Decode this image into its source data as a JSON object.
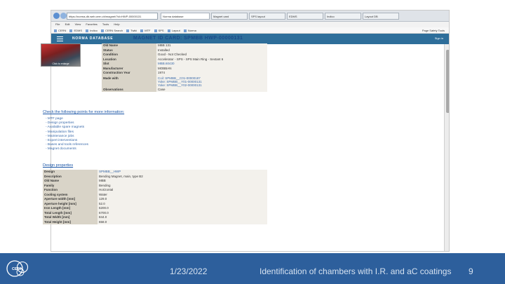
{
  "browser": {
    "url": "https://norma-db.web.cern.ch/magnet/?id=HWP-00000131",
    "tabs": [
      {
        "label": "Norma database",
        "active": true
      },
      {
        "label": "Magnet card",
        "active": false
      },
      {
        "label": "SPS layout",
        "active": false
      },
      {
        "label": "EDMS",
        "active": false
      },
      {
        "label": "Indico",
        "active": false
      },
      {
        "label": "Layout DB",
        "active": false
      }
    ],
    "menu": [
      "File",
      "Edit",
      "View",
      "Favorites",
      "Tools",
      "Help"
    ],
    "favorites": [
      "CERN",
      "EDMS",
      "Indico",
      "CERN Search",
      "Twiki",
      "MTF",
      "SPS",
      "Layout",
      "Norma"
    ],
    "toolbar_right": "Page  Safety  Tools"
  },
  "app": {
    "title": "NORMA DATABASE",
    "signin": "Sign in"
  },
  "card": {
    "title": "MAGNET ID CARD: SPMBB   HWP-00000131",
    "photo_caption": "Click to enlarge",
    "rows": [
      {
        "key": "Old Name",
        "value": "MBB 131"
      },
      {
        "key": "Status",
        "value": "Installed"
      },
      {
        "key": "Condition",
        "value": "Good - Not Checked"
      },
      {
        "key": "Location",
        "value": "Accelerator - SPS - SPS Main Ring - Sextant 6"
      },
      {
        "key": "Slot",
        "value": "MBB.60430"
      },
      {
        "key": "Manufacturer",
        "value": "MOBBAN"
      },
      {
        "key": "Construction Year",
        "value": "1974"
      },
      {
        "key": "Made with",
        "values": [
          "Coil: SPMBB__C01-00000187",
          "Yoke: SPMBB__Y01-00000131",
          "Yoke: SPMBB__Y02-00000131"
        ]
      },
      {
        "key": "Observations",
        "value": "Case"
      }
    ]
  },
  "more_info": {
    "heading": "Check the following points for more information:",
    "links": [
      "- MTF page",
      "- Design properties",
      "- Available spare magnets",
      "- Manipulation files",
      "- Maintenance jobs",
      "- Expert interventions",
      "- Bases and tools references",
      "- Magnet documents"
    ]
  },
  "design": {
    "heading": "Design properties",
    "rows": [
      {
        "key": "Design",
        "value": "SPMBB__HWP",
        "link": true
      },
      {
        "key": "Description",
        "value": "Bending Magnet, main, type B2"
      },
      {
        "key": "Old Name",
        "value": "MBB"
      },
      {
        "key": "Family",
        "value": "Bending"
      },
      {
        "key": "Function",
        "value": "Horizontal"
      },
      {
        "key": "Cooling system",
        "value": "Water"
      },
      {
        "key": "Aperture width [mm]",
        "value": "129.0"
      },
      {
        "key": "Aperture height [mm]",
        "value": "52.0"
      },
      {
        "key": "Iron Length [mm]",
        "value": "6200.0"
      },
      {
        "key": "Total Length [mm]",
        "value": "6700.0"
      },
      {
        "key": "Total Width [mm]",
        "value": "844.0"
      },
      {
        "key": "Total Height [mm]",
        "value": "658.0"
      }
    ]
  },
  "footer": {
    "date": "1/23/2022",
    "description": "Identification of chambers with I.R. and aC coatings",
    "page": "9",
    "logo_text": "CERN"
  },
  "colors": {
    "footer_bg": "#2d5f9c",
    "header_bg": "#2e6e9a",
    "title_blue": "#1a4a8a",
    "table_key_bg": "#d9d4c8"
  }
}
